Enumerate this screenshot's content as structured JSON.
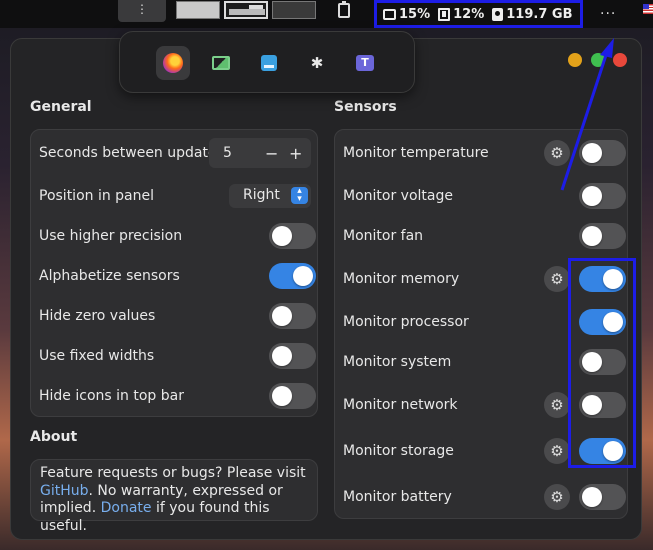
{
  "topbar": {
    "menu_label": "⋮",
    "cpu": "15%",
    "memory": "12%",
    "storage": "119.7 GB",
    "more_label": "..."
  },
  "general": {
    "title": "General",
    "update_label": "Seconds between updates",
    "update_value": "5",
    "minus": "−",
    "plus": "+",
    "position_label": "Position in panel",
    "position_value": "Right",
    "higher_precision_label": "Use higher precision",
    "alphabetize_label": "Alphabetize sensors",
    "hide_zero_label": "Hide zero values",
    "fixed_widths_label": "Use fixed widths",
    "hide_icons_label": "Hide icons in top bar",
    "toggles": {
      "higher_precision": false,
      "alphabetize": true,
      "hide_zero": false,
      "fixed_widths": false,
      "hide_icons": false
    }
  },
  "about": {
    "title": "About",
    "text1": "Feature requests or bugs? Please visit ",
    "github": "GitHub",
    "text2": ". No warranty, expressed or implied. ",
    "donate": "Donate",
    "text3": " if you found this useful."
  },
  "sensors": {
    "title": "Sensors",
    "items": [
      {
        "label": "Monitor temperature",
        "on": false,
        "gear": true
      },
      {
        "label": "Monitor voltage",
        "on": false,
        "gear": false
      },
      {
        "label": "Monitor fan",
        "on": false,
        "gear": false
      },
      {
        "label": "Monitor memory",
        "on": true,
        "gear": true
      },
      {
        "label": "Monitor processor",
        "on": true,
        "gear": false
      },
      {
        "label": "Monitor system",
        "on": false,
        "gear": false
      },
      {
        "label": "Monitor network",
        "on": false,
        "gear": true
      },
      {
        "label": "Monitor storage",
        "on": true,
        "gear": true
      },
      {
        "label": "Monitor battery",
        "on": false,
        "gear": true
      }
    ]
  },
  "colors": {
    "accent": "#3584e4",
    "annotation": "#1d1de6"
  }
}
